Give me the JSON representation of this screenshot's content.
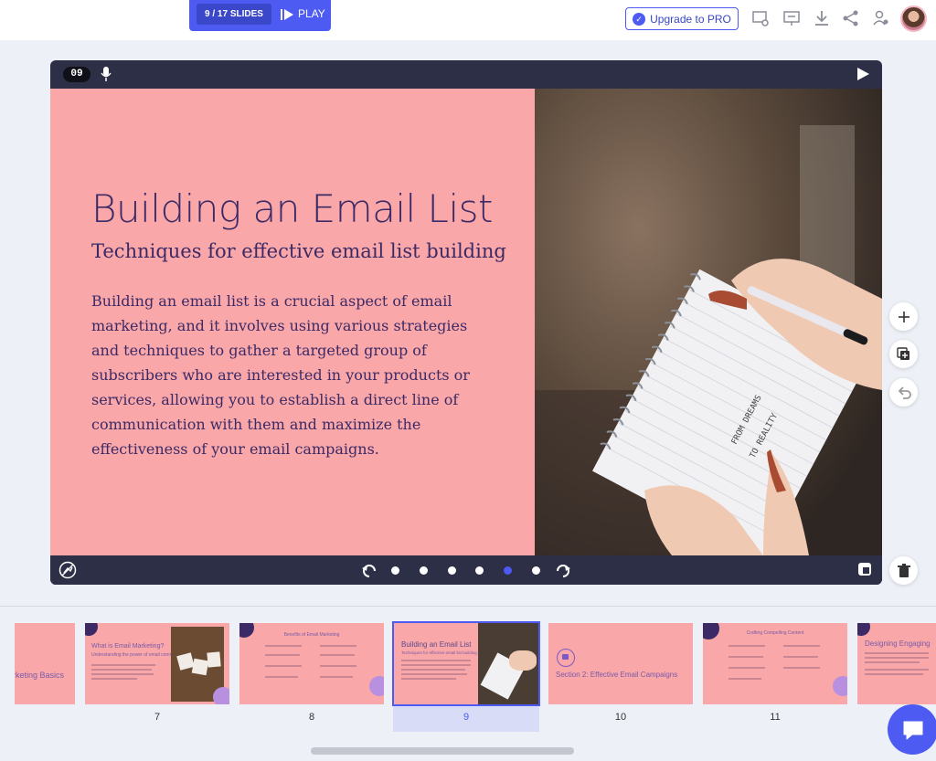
{
  "header": {
    "slides_counter": "9 / 17 SLIDES",
    "play_label": "PLAY",
    "upgrade_label": "Upgrade to PRO",
    "icons": [
      "slide-settings-icon",
      "presenter-view-icon",
      "download-icon",
      "share-icon",
      "collaborators-icon"
    ]
  },
  "slide": {
    "number": "09",
    "title": "Building an Email List",
    "subtitle": "Techniques for effective email list building",
    "body": "Building an email list is a crucial aspect of email marketing, and it involves using various strategies and techniques to gather a targeted group of subscribers who are interested in your products or services, allowing you to establish a direct line of communication with them and maximize the effectiveness of your email campaigns.",
    "photo_handwriting": [
      "FROM DREAMS",
      "TO REALITY"
    ]
  },
  "controls": {
    "dots_count": 6,
    "active_dot": 5
  },
  "thumbnails": [
    {
      "number": "",
      "title": "rketing Basics",
      "kind": "section"
    },
    {
      "number": "7",
      "title": "What is Email Marketing?",
      "subtitle": "Understanding the power of email communication",
      "kind": "image"
    },
    {
      "number": "8",
      "title": "Benefits of Email Marketing",
      "kind": "grid"
    },
    {
      "number": "9",
      "title": "Building an Email List",
      "subtitle": "Techniques for effective email list building",
      "kind": "image",
      "selected": true
    },
    {
      "number": "10",
      "title": "Section 2: Effective Email Campaigns",
      "kind": "section"
    },
    {
      "number": "11",
      "title": "Crafting Compelling Content",
      "kind": "grid"
    },
    {
      "number": "",
      "title": "Designing Engaging",
      "kind": "text"
    }
  ],
  "colors": {
    "accent": "#4d5bf2",
    "slide_bg": "#f9a7a8",
    "slide_text": "#3b2a66",
    "frame": "#2c2f45"
  }
}
